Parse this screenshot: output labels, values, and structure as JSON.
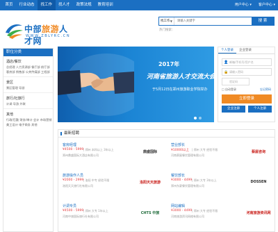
{
  "topnav": {
    "items": [
      "首页",
      "行业动态",
      "找工作",
      "找人才",
      "政策法规",
      "教育培训"
    ],
    "active_index": 2,
    "user_center": "用户中心 ▾",
    "client_center": "客户中心 ▾"
  },
  "logo": {
    "name_pre": "中部",
    "name_hl": "旅游",
    "name_post": "人才网",
    "url": "WWW.ZBLYRC.CN"
  },
  "search": {
    "type": "找工作",
    "type_caret": "▼",
    "placeholder": "请输入关键字",
    "button": "搜 索",
    "hot": "热门搜索："
  },
  "sidebar": {
    "header": "职位分类",
    "groups": [
      {
        "title": "酒店/餐饮",
        "links": "总经理 人力资源部 餐厅部 前厅部 客房部 销售部 公关传媒部 工程部"
      },
      {
        "title": "景区",
        "links": "景区管理 导游"
      },
      {
        "title": "旅行/社旅行",
        "links": "计调 导游 外联"
      },
      {
        "title": "其他",
        "links": "行政/后勤 财务/审计 会计 市场营销 美工设计 电子商务 其他"
      }
    ]
  },
  "banner": {
    "year": "2017年",
    "title": "河南省旅游人才交流大会",
    "subtitle": "于5月12日在郑州旅游职业学院举办"
  },
  "login": {
    "tab_personal": "个人登录",
    "tab_company": "企业登录",
    "username_icon": "person-icon",
    "username_glyph": "👤",
    "username_placeholder": "邮箱/手机号/用户名",
    "password_icon": "lock-icon",
    "password_glyph": "🔒",
    "password_placeholder": "请输入密码",
    "code_placeholder": "验证码",
    "remember": "□ 自动登录",
    "forgot": "忘记密码",
    "button": "立即登录",
    "register_company": "企业注册",
    "register_personal": "个人注册"
  },
  "jobs": {
    "header": "最新招聘",
    "items": [
      {
        "title": "客房经理",
        "salary": "¥4500 - 5999",
        "meta": "| 郑州 本科以上 3年以上",
        "company": "郑州鼎盛国际大酒店有限公司",
        "logo": "鼎盛国际",
        "logo_color": "#2b2b2b"
      },
      {
        "title": "营业部长",
        "salary": "¥10000以上",
        "meta": "| 郑州 大专 经验不限",
        "company": "河南蔡屋餐饮管理有限公司",
        "logo": "蔡屋咨询",
        "logo_color": "#c9201b"
      },
      {
        "title": "旅游操作人员",
        "salary": "¥2000 - 2999",
        "meta": "| 洛阳 中专 经验不限",
        "company": "洛阳天天旅行社有限公司",
        "logo": "洛阳天天旅游",
        "logo_color": "#c9201b"
      },
      {
        "title": "餐饮部长",
        "salary": "¥3000 - 4499",
        "meta": "| 郑州 大专 3年以上",
        "company": "郑州东豪餐饮管理有限公司",
        "logo": "DOSSEN",
        "logo_color": "#2b2b2b"
      },
      {
        "title": "计调专员",
        "salary": "¥4500 - 5999",
        "meta": "| 郑州 大专 1年以上",
        "company": "河南中旅国际旅行社有限公司",
        "logo": "CHTS 中旅",
        "logo_color": "#1e6b3a"
      },
      {
        "title": "网站编辑",
        "salary": "¥3000 - 4499",
        "meta": "| 郑州 大专 经验不限",
        "company": "河南旅游资讯网络有限公司",
        "logo": "河南旅游资讯网",
        "logo_color": "#c9201b"
      }
    ]
  },
  "colors": {
    "brand": "#1b6fc2",
    "accent": "#f08a24",
    "salary": "#e4393c"
  }
}
